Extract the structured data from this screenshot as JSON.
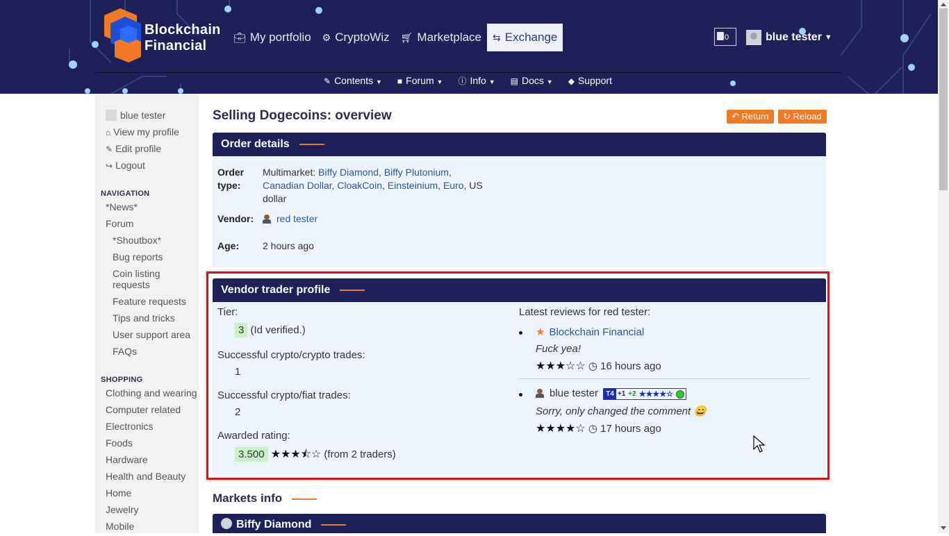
{
  "header": {
    "logo_line1": "Blockchain",
    "logo_line2": "Financial",
    "nav": [
      {
        "label": "My portfolio",
        "icon": "briefcase-icon"
      },
      {
        "label": "CryptoWiz",
        "icon": "gauge-icon"
      },
      {
        "label": "Marketplace",
        "icon": "cart-icon"
      },
      {
        "label": "Exchange",
        "icon": "exchange-icon",
        "active": true
      }
    ],
    "cart_count": "0",
    "username": "blue tester",
    "subnav": [
      {
        "label": "Contents",
        "icon": "contents-icon"
      },
      {
        "label": "Forum",
        "icon": "folder-icon"
      },
      {
        "label": "Info",
        "icon": "info-icon"
      },
      {
        "label": "Docs",
        "icon": "book-icon"
      },
      {
        "label": "Support",
        "icon": "support-icon"
      }
    ]
  },
  "sidebar": {
    "user": "blue tester",
    "view_profile": "View my profile",
    "edit_profile": "Edit profile",
    "logout": "Logout",
    "nav_heading": "NAVIGATION",
    "nav_items": [
      "*News*",
      "Forum",
      "*Shoutbox*",
      "Bug reports",
      "Coin listing",
      "requests",
      "Feature requests",
      "Tips and tricks",
      "User support area",
      "FAQs"
    ],
    "shop_heading": "SHOPPING",
    "shop_items": [
      "Clothing and wearing",
      "Computer related",
      "Electronics",
      "Foods",
      "Hardware",
      "Health and Beauty",
      "Home",
      "Jewelry",
      "Mobile"
    ]
  },
  "page": {
    "title": "Selling Dogecoins: overview",
    "return_label": "Return",
    "reload_label": "Reload"
  },
  "order": {
    "heading": "Order details",
    "type_label_1": "Order",
    "type_label_2": "type:",
    "type_prefix": "Multimarket: ",
    "markets_line1": [
      "Biffy Diamond",
      "Biffy Plutonium"
    ],
    "markets_line2": [
      "Canadian Dollar",
      "CloakCoin",
      "Einsteinium",
      "Euro"
    ],
    "us_dollar_1": "US",
    "us_dollar_2": "dollar",
    "vendor_label": "Vendor:",
    "vendor": "red tester",
    "age_label": "Age:",
    "age": "2 hours ago"
  },
  "vendor_profile": {
    "heading": "Vendor trader profile",
    "tier_label": "Tier:",
    "tier": "3",
    "tier_note": "(Id verified.)",
    "crypto_crypto_label": "Successful crypto/crypto trades:",
    "crypto_crypto": "1",
    "crypto_fiat_label": "Successful crypto/fiat trades:",
    "crypto_fiat": "2",
    "rating_label": "Awarded rating:",
    "rating": "3.500",
    "rating_stars": "★★★⯪☆",
    "rating_note": "(from 2 traders)",
    "reviews_heading": "Latest reviews for red tester:",
    "reviews": [
      {
        "author": "Blockchain Financial",
        "text": "Fuck yea!",
        "stars": "★★★☆☆",
        "time": "16 hours ago"
      },
      {
        "author": "blue tester",
        "text": "Sorry, only changed the comment",
        "emoji": "😄",
        "stars": "★★★★☆",
        "time": "17 hours ago",
        "tag_tier": "T4",
        "tag_plus1": "+1",
        "tag_plus2": "+2",
        "tag_stars": "★★★★☆"
      }
    ]
  },
  "markets": {
    "heading": "Markets info",
    "first": "Biffy Diamond"
  },
  "colors": {
    "header_bg": "#1e2159",
    "accent": "#f07a25",
    "highlight": "#d9121e"
  }
}
